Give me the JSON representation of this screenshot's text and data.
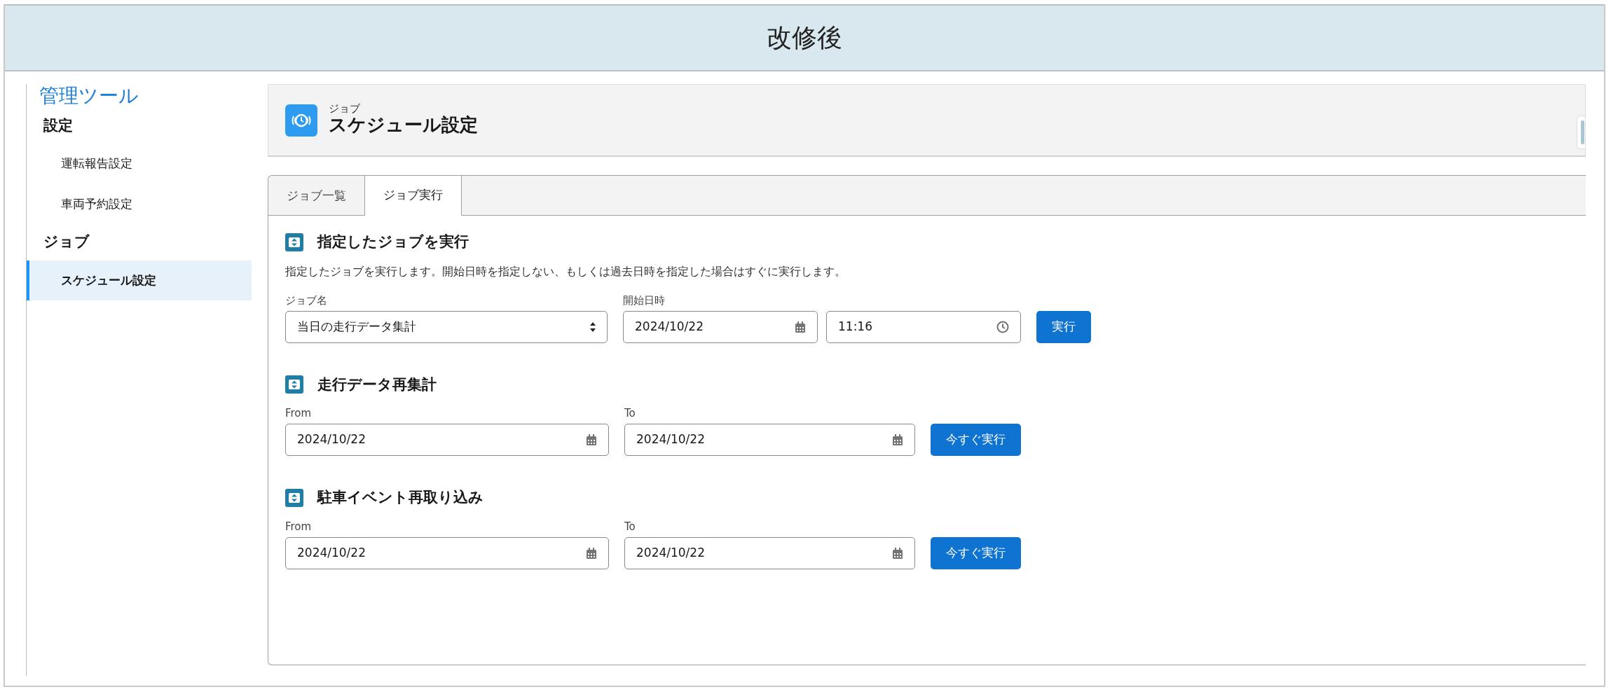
{
  "banner": {
    "title": "改修後"
  },
  "sidebar": {
    "title": "管理ツール",
    "groups": [
      {
        "label": "設定",
        "items": [
          {
            "label": "運転報告設定",
            "selected": false
          },
          {
            "label": "車両予約設定",
            "selected": false
          }
        ]
      },
      {
        "label": "ジョブ",
        "items": [
          {
            "label": "スケジュール設定",
            "selected": true
          }
        ]
      }
    ]
  },
  "page_header": {
    "object": "ジョブ",
    "title": "スケジュール設定"
  },
  "tabs": [
    {
      "label": "ジョブ一覧",
      "selected": false
    },
    {
      "label": "ジョブ実行",
      "selected": true
    }
  ],
  "sections": [
    {
      "kind": "job",
      "title": "指定したジョブを実行",
      "description": "指定したジョブを実行します。開始日時を指定しない、もしくは過去日時を指定した場合はすぐに実行します。",
      "fields": [
        {
          "kind": "select",
          "label": "ジョブ名",
          "value": "当日の走行データ集計"
        },
        {
          "kind": "date",
          "label": "開始日時",
          "value": "2024/10/22"
        },
        {
          "kind": "time",
          "value": "11:16"
        }
      ],
      "button": "実行"
    },
    {
      "kind": "range",
      "title": "走行データ再集計",
      "fields": [
        {
          "kind": "date",
          "label": "From",
          "value": "2024/10/22"
        },
        {
          "kind": "date",
          "label": "To",
          "value": "2024/10/22"
        }
      ],
      "button": "今すぐ実行"
    },
    {
      "kind": "range",
      "title": "駐車イベント再取り込み",
      "fields": [
        {
          "kind": "date",
          "label": "From",
          "value": "2024/10/22"
        },
        {
          "kind": "date",
          "label": "To",
          "value": "2024/10/22"
        }
      ],
      "button": "今すぐ実行"
    }
  ]
}
